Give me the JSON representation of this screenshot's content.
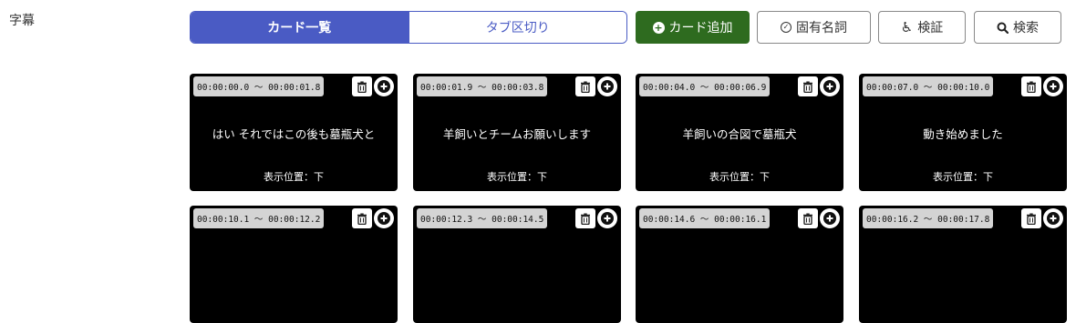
{
  "section": {
    "label": "字幕"
  },
  "toolbar": {
    "tab_cards": "カード一覧",
    "tab_split": "タブ区切り",
    "add_card": "カード追加",
    "proper_nouns": "固有名詞",
    "verify": "検証",
    "search": "検索"
  },
  "colors": {
    "accent": "#4a5bc4",
    "add_button": "#2e6b1f",
    "card_bg": "#000000"
  },
  "cards": [
    {
      "timecode": "00:00:00.0 〜 00:00:01.8",
      "text": "はい それではこの後も墓瓶犬と",
      "position": "表示位置：下"
    },
    {
      "timecode": "00:00:01.9 〜 00:00:03.8",
      "text": "羊飼いとチームお願いします",
      "position": "表示位置：下"
    },
    {
      "timecode": "00:00:04.0 〜 00:00:06.9",
      "text": "羊飼いの合図で墓瓶犬",
      "position": "表示位置：下"
    },
    {
      "timecode": "00:00:07.0 〜 00:00:10.0",
      "text": "動き始めました",
      "position": "表示位置：下"
    },
    {
      "timecode": "00:00:10.1 〜 00:00:12.2",
      "text": "",
      "position": ""
    },
    {
      "timecode": "00:00:12.3 〜 00:00:14.5",
      "text": "",
      "position": ""
    },
    {
      "timecode": "00:00:14.6 〜 00:00:16.1",
      "text": "",
      "position": ""
    },
    {
      "timecode": "00:00:16.2 〜 00:00:17.8",
      "text": "",
      "position": ""
    }
  ]
}
